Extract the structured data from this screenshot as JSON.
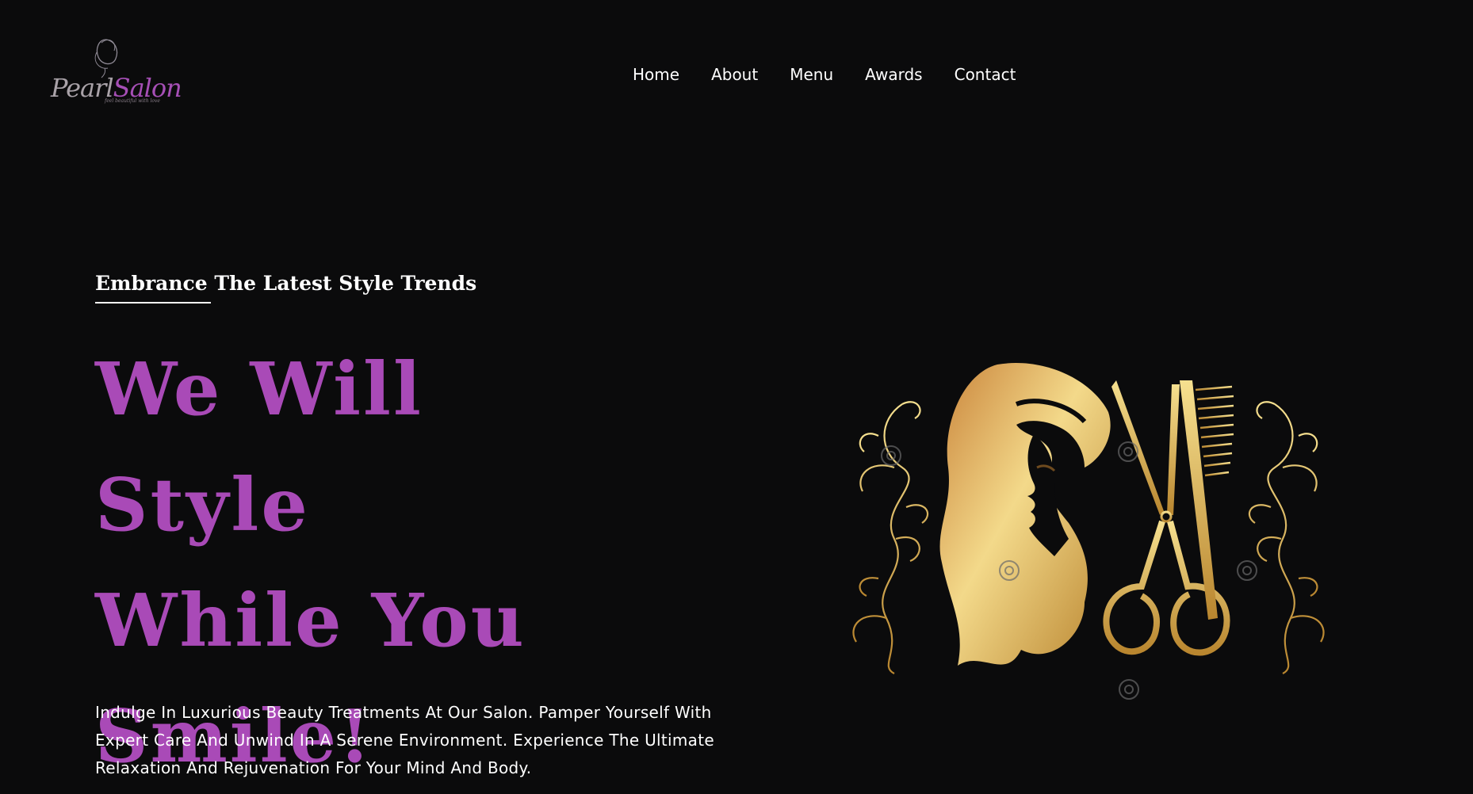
{
  "brand": {
    "name_part1": "Pearl",
    "name_part2": "Salon",
    "tagline": "feel beautiful with love",
    "colors": {
      "accent": "#a94ab7",
      "gold": "#e6c25a",
      "background": "#0b0b0c"
    }
  },
  "nav": {
    "items": [
      {
        "label": "Home"
      },
      {
        "label": "About"
      },
      {
        "label": "Menu"
      },
      {
        "label": "Awards"
      },
      {
        "label": "Contact"
      }
    ]
  },
  "hero": {
    "eyebrow": "Embrance The Latest Style Trends",
    "headline_line1": "We Will Style",
    "headline_line2": "While You",
    "headline_line3": "Smile!",
    "description": "Indulge In Luxurious Beauty Treatments At Our Salon. Pamper Yourself With Expert Care And Unwind In A Serene Environment. Experience The Ultimate Relaxation And Rejuvenation For Your Mind And Body.",
    "illustration_icon": "woman-profile-scissors-comb-illustration"
  }
}
